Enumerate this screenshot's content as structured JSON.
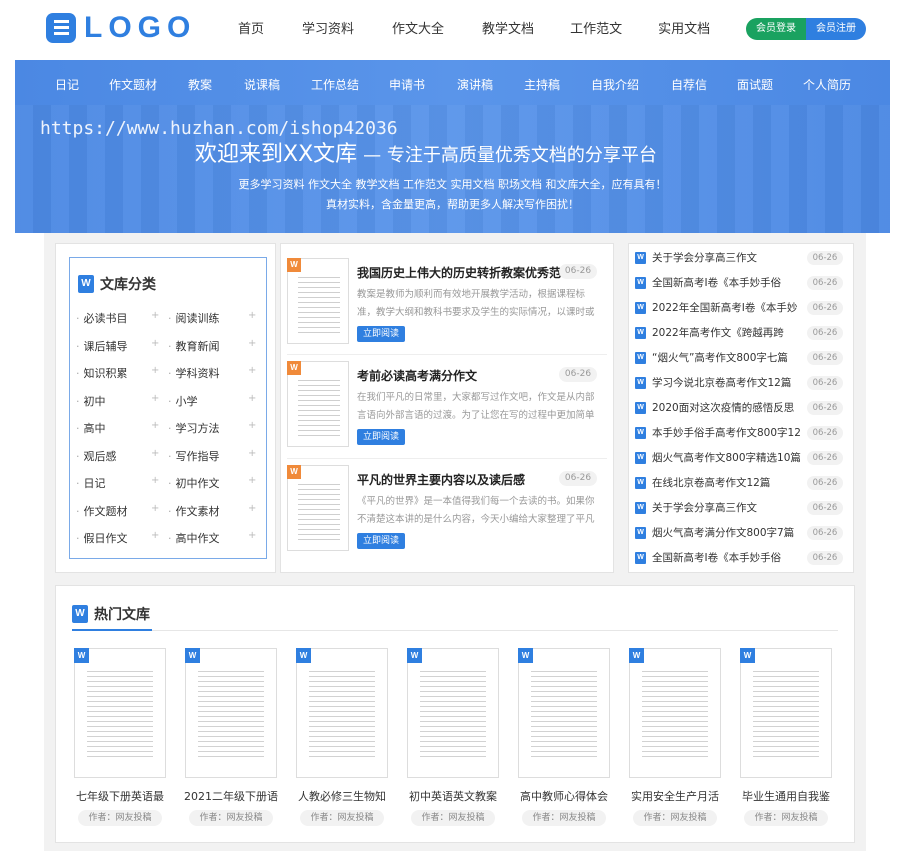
{
  "logo": {
    "text": "LOGO"
  },
  "topnav": [
    "首页",
    "学习资料",
    "作文大全",
    "教学文档",
    "工作范文",
    "实用文档"
  ],
  "auth": {
    "login": "会员登录",
    "register": "会员注册"
  },
  "subnav": [
    "日记",
    "作文题材",
    "教案",
    "说课稿",
    "工作总结",
    "申请书",
    "演讲稿",
    "主持稿",
    "自我介绍",
    "自荐信",
    "面试题",
    "个人简历"
  ],
  "banner": {
    "title": "欢迎来到XX文库",
    "slogan": "— 专注于高质量优秀文档的分享平台",
    "line1": "更多学习资料 作文大全 教学文档 工作范文 实用文档 职场文档 和文库大全，应有具有！",
    "line2": "真材实料，含金量更高，帮助更多人解决写作困扰！",
    "watermark": "https://www.huzhan.com/ishop42036"
  },
  "categories": {
    "title": "文库分类",
    "items": [
      "必读书目",
      "阅读训练",
      "课后辅导",
      "教育新闻",
      "知识积累",
      "学科资料",
      "初中",
      "小学",
      "高中",
      "学习方法",
      "观后感",
      "写作指导",
      "日记",
      "初中作文",
      "作文题材",
      "作文素材",
      "假日作文",
      "高中作文"
    ]
  },
  "featured": [
    {
      "title": "我国历史上伟大的历史转折教案优秀范",
      "date": "06-26",
      "desc": "教案是教师为顺利而有效地开展教学活动，根据课程标准，教学大纲和教科书要求及学生的实际情况，以课时或",
      "button": "立即阅读"
    },
    {
      "title": "考前必读高考满分作文",
      "date": "06-26",
      "desc": "在我们平凡的日常里，大家都写过作文吧，作文是从内部言语向外部言语的过渡。为了让您在写的过程中更加简单",
      "button": "立即阅读"
    },
    {
      "title": "平凡的世界主要内容以及读后感",
      "date": "06-26",
      "desc": "《平凡的世界》是一本值得我们每一个去读的书。如果你不清楚这本讲的是什么内容，今天小编给大家整理了平凡",
      "button": "立即阅读"
    }
  ],
  "latest": [
    {
      "title": "关于学会分享高三作文",
      "date": "06-26"
    },
    {
      "title": "全国新高考I卷《本手妙手俗",
      "date": "06-26"
    },
    {
      "title": "2022年全国新高考I卷《本手妙",
      "date": "06-26"
    },
    {
      "title": "2022年高考作文《跨越再跨",
      "date": "06-26"
    },
    {
      "title": "“烟火气”高考作文800字七篇",
      "date": "06-26"
    },
    {
      "title": "学习今说北京卷高考作文12篇",
      "date": "06-26"
    },
    {
      "title": "2020面对这次疫情的感悟反思",
      "date": "06-26"
    },
    {
      "title": "本手妙手俗手高考作文800字12",
      "date": "06-26"
    },
    {
      "title": "烟火气高考作文800字精选10篇",
      "date": "06-26"
    },
    {
      "title": "在线北京卷高考作文12篇",
      "date": "06-26"
    },
    {
      "title": "关于学会分享高三作文",
      "date": "06-26"
    },
    {
      "title": "烟火气高考满分作文800字7篇",
      "date": "06-26"
    },
    {
      "title": "全国新高考I卷《本手妙手俗",
      "date": "06-26"
    }
  ],
  "hot": {
    "title": "热门文库",
    "items": [
      {
        "name": "七年级下册英语最",
        "author": "作者：网友投稿"
      },
      {
        "name": "2021二年级下册语",
        "author": "作者：网友投稿"
      },
      {
        "name": "人教必修三生物知",
        "author": "作者：网友投稿"
      },
      {
        "name": "初中英语英文教案",
        "author": "作者：网友投稿"
      },
      {
        "name": "高中教师心得体会",
        "author": "作者：网友投稿"
      },
      {
        "name": "实用安全生产月活",
        "author": "作者：网友投稿"
      },
      {
        "name": "毕业生通用自我鉴",
        "author": "作者：网友投稿"
      }
    ]
  },
  "icons": {
    "doc": "W"
  },
  "colors": {
    "brand": "#2f7fe0",
    "login": "#1aa260",
    "featured_badge": "#f08a3a"
  }
}
